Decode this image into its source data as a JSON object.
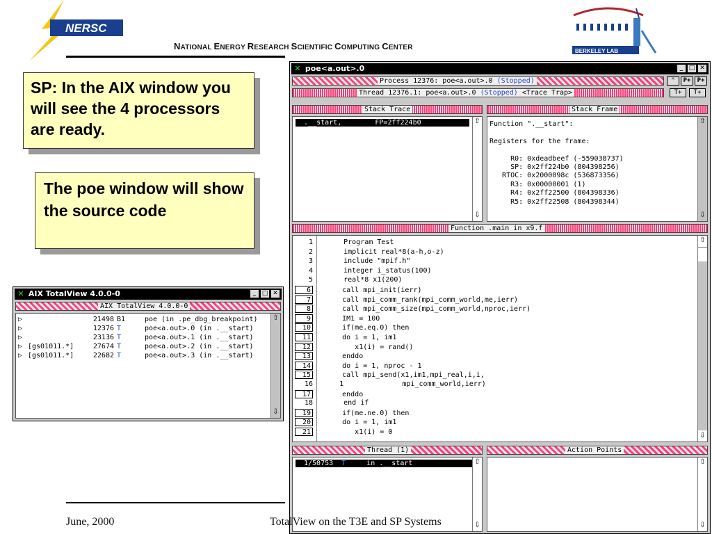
{
  "header": {
    "logo_text": "NERSC",
    "title_parts": [
      {
        "big": "N",
        "small": "ATIONAL "
      },
      {
        "big": "E",
        "small": "NERGY "
      },
      {
        "big": "R",
        "small": "ESEARCH "
      },
      {
        "big": "S",
        "small": "CIENTIFIC "
      },
      {
        "big": "C",
        "small": "OMPUTING "
      },
      {
        "big": "C",
        "small": "ENTER"
      }
    ],
    "berkeley_logo_text": "BERKELEY LAB"
  },
  "callouts": {
    "sp": "SP: In the AIX window you will see the 4 processors are ready.",
    "poe": "The poe window will show the source code"
  },
  "aix_window": {
    "title": "AIX TotalView 4.0.0-0",
    "header_label": "AIX TotalView 4.0.0-0",
    "processes": [
      {
        "host": "",
        "pid": "21498",
        "state": "B1",
        "desc": "poe (in .pe_dbg_breakpoint)"
      },
      {
        "host": "",
        "pid": "12376",
        "state": "T",
        "desc": "poe<a.out>.0 (in .__start)"
      },
      {
        "host": "",
        "pid": "23136",
        "state": "T",
        "desc": "poe<a.out>.1 (in .__start)"
      },
      {
        "host": "[gs01011.*]",
        "pid": "27674",
        "state": "T",
        "desc": "poe<a.out>.2 (in .__start)"
      },
      {
        "host": "[gs01011.*]",
        "pid": "22682",
        "state": "T",
        "desc": "poe<a.out>.3 (in .__start)"
      }
    ]
  },
  "poe_window": {
    "title": "poe<a.out>.0",
    "process_bar": {
      "text": "Process 12376: poe<a.out>.0 ",
      "status": "(Stopped)"
    },
    "thread_bar": {
      "text": "Thread 12376.1: poe<a.out>.0 ",
      "status": "(Stopped)",
      "extra": " <Trace Trap>"
    },
    "nav_buttons": [
      "P+",
      "P+",
      "T+",
      "T+"
    ],
    "stack_trace": {
      "label": "Stack Trace",
      "entry": "  .__start,        FP=2ff224b0"
    },
    "stack_frame": {
      "label": "Stack Frame",
      "lines": [
        "Function \".__start\":",
        "",
        "Registers for the frame:",
        "",
        "     R0: 0xdeadbeef (-559038737)",
        "     SP: 0x2ff224b0 (804398256)",
        "   RTOC: 0x2000098c (536873356)",
        "     R3: 0x00000001 (1)",
        "     R4: 0x2ff22500 (804398336)",
        "     R5: 0x2ff22508 (804398344)"
      ]
    },
    "function_bar": "Function .main in x9.f",
    "source": [
      {
        "n": "1",
        "box": false,
        "code": "      Program Test"
      },
      {
        "n": "2",
        "box": false,
        "code": "      implicit real*8(a-h,o-z)"
      },
      {
        "n": "3",
        "box": false,
        "code": "      include \"mpif.h\""
      },
      {
        "n": "4",
        "box": false,
        "code": "      integer i_status(100)"
      },
      {
        "n": "5",
        "box": false,
        "code": "      real*8 x1(200)"
      },
      {
        "n": "6",
        "box": true,
        "code": "      call mpi_init(ierr)"
      },
      {
        "n": "7",
        "box": true,
        "code": "      call mpi_comm_rank(mpi_comm_world,me,ierr)"
      },
      {
        "n": "8",
        "box": true,
        "code": "      call mpi_comm_size(mpi_comm_world,nproc,ierr)"
      },
      {
        "n": "9",
        "box": true,
        "code": "      IM1 = 100"
      },
      {
        "n": "10",
        "box": true,
        "code": "      if(me.eq.0) then"
      },
      {
        "n": "11",
        "box": true,
        "code": "      do i = 1, im1"
      },
      {
        "n": "12",
        "box": true,
        "code": "         x1(i) = rand()"
      },
      {
        "n": "13",
        "box": true,
        "code": "      enddo"
      },
      {
        "n": "14",
        "box": true,
        "code": "      do i = 1, nproc - 1"
      },
      {
        "n": "15",
        "box": true,
        "code": "      call mpi_send(x1,im1,mpi_real,i,i,"
      },
      {
        "n": "16",
        "box": false,
        "code": "     1              mpi_comm_world,ierr)"
      },
      {
        "n": "17",
        "box": true,
        "code": "      enddo"
      },
      {
        "n": "18",
        "box": false,
        "code": "      end if"
      },
      {
        "n": "19",
        "box": true,
        "code": "      if(me.ne.0) then"
      },
      {
        "n": "20",
        "box": true,
        "code": "      do i = 1, im1"
      },
      {
        "n": "21",
        "box": true,
        "code": "         x1(i) = 0"
      }
    ],
    "thread_pane": {
      "label": "Thread (1)",
      "entry_id": "1/50753",
      "entry_state": "T",
      "entry_loc": "in .__start"
    },
    "action_points": {
      "label": "Action Points"
    }
  },
  "footer": {
    "date": "June, 2000",
    "title": "TotalView on the T3E and SP Systems"
  },
  "colors": {
    "callout_bg": "#ffffbe",
    "hatch_pink": "#ff3d7a",
    "status_blue": "#2a47d8",
    "window_gray": "#c9c9c9"
  }
}
